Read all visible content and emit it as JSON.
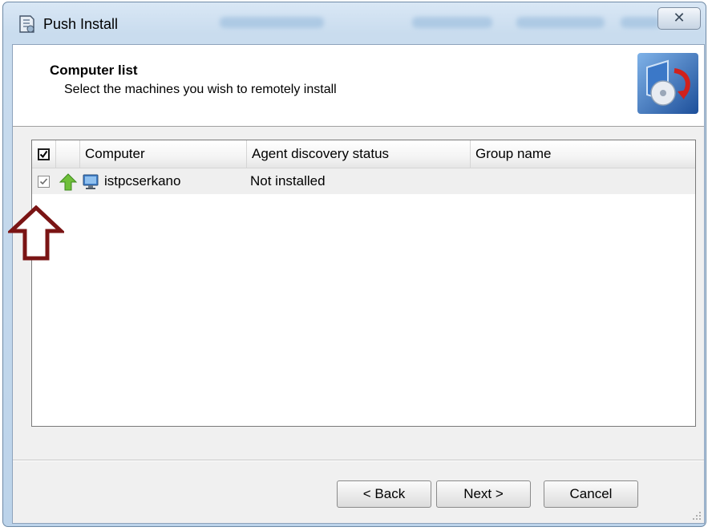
{
  "window": {
    "title": "Push Install",
    "close_glyph": "✕"
  },
  "header": {
    "title": "Computer list",
    "subtitle": "Select the machines you wish to remotely install",
    "logo_icon": "install-disc-icon"
  },
  "list": {
    "columns": [
      "Computer",
      "Agent discovery status",
      "Group name"
    ],
    "select_all_checked": true,
    "rows": [
      {
        "checked": true,
        "status_icon": "green-up-arrow-icon",
        "computer_icon": "computer-monitor-icon",
        "computer": "istpcserkano",
        "agent_status": "Not installed",
        "group": ""
      }
    ]
  },
  "buttons": {
    "back": "< Back",
    "next": "Next >",
    "cancel": "Cancel"
  },
  "annotation": {
    "icon": "red-outline-up-arrow-icon",
    "color": "#7a1414"
  }
}
